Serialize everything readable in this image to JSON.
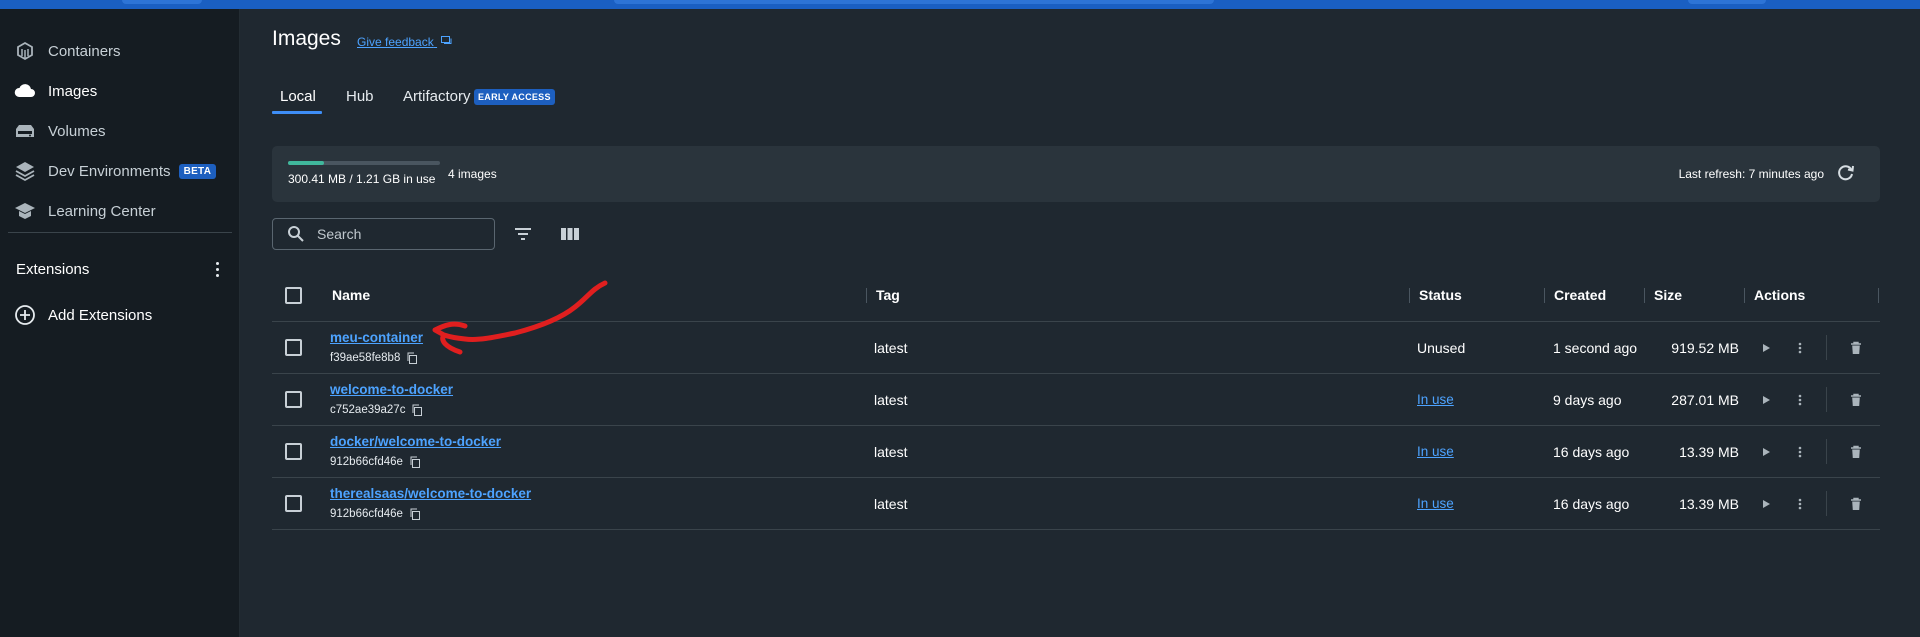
{
  "sidebar": {
    "items": [
      {
        "label": "Containers",
        "icon": "containers-icon"
      },
      {
        "label": "Images",
        "icon": "cloud-icon"
      },
      {
        "label": "Volumes",
        "icon": "volumes-icon"
      },
      {
        "label": "Dev Environments",
        "icon": "dev-environments-icon",
        "badge": "BETA"
      },
      {
        "label": "Learning Center",
        "icon": "learning-center-icon"
      }
    ],
    "extensions_label": "Extensions",
    "add_extensions_label": "Add Extensions"
  },
  "header": {
    "title": "Images",
    "feedback_link": "Give feedback"
  },
  "tabs": [
    {
      "label": "Local",
      "active": true
    },
    {
      "label": "Hub",
      "active": false
    },
    {
      "label": "Artifactory",
      "active": false,
      "badge": "EARLY ACCESS"
    }
  ],
  "usage": {
    "text": "300.41 MB / 1.21 GB in use",
    "fraction_used": 0.24,
    "image_count": "4 images",
    "last_refresh": "Last refresh: 7 minutes ago"
  },
  "search": {
    "placeholder": "Search"
  },
  "table": {
    "columns": [
      "Name",
      "Tag",
      "Status",
      "Created",
      "Size",
      "Actions"
    ],
    "rows": [
      {
        "name": "meu-container",
        "id": "f39ae58fe8b8",
        "tag": "latest",
        "status": "Unused",
        "status_link": false,
        "created": "1 second ago",
        "size": "919.52 MB"
      },
      {
        "name": "welcome-to-docker",
        "id": "c752ae39a27c",
        "tag": "latest",
        "status": "In use",
        "status_link": true,
        "created": "9 days ago",
        "size": "287.01 MB"
      },
      {
        "name": "docker/welcome-to-docker",
        "id": "912b66cfd46e",
        "tag": "latest",
        "status": "In use",
        "status_link": true,
        "created": "16 days ago",
        "size": "13.39 MB"
      },
      {
        "name": "therealsaas/welcome-to-docker",
        "id": "912b66cfd46e",
        "tag": "latest",
        "status": "In use",
        "status_link": true,
        "created": "16 days ago",
        "size": "13.39 MB"
      }
    ]
  },
  "colors": {
    "accent": "#3e8ef7",
    "link": "#4da3ff",
    "annotation": "#e01f1f",
    "usage_fill": "#40b79c"
  }
}
